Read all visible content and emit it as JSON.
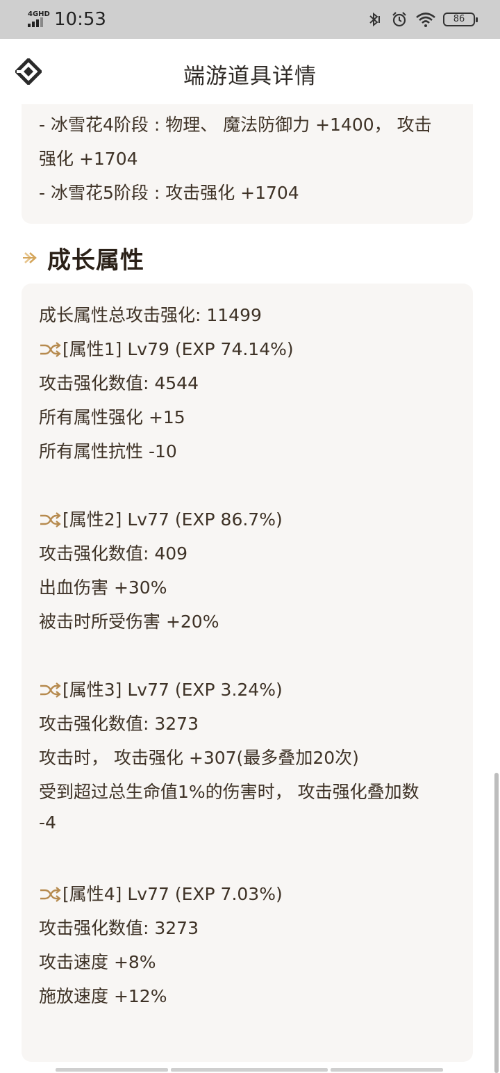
{
  "status_bar": {
    "network": "4GHD",
    "time": "10:53",
    "battery": "86"
  },
  "header": {
    "title": "端游道具详情"
  },
  "set_effects": {
    "lines": [
      "- 冰雪花4阶段 : 物理、 魔法防御力 +1400， 攻击",
      "强化 +1704",
      "- 冰雪花5阶段 : 攻击强化 +1704"
    ]
  },
  "growth": {
    "section_title": "成长属性",
    "total": "成长属性总攻击强化: 11499",
    "attributes": [
      {
        "header": "[属性1] Lv79 (EXP 74.14%)",
        "lines": [
          "攻击强化数值:  4544",
          "所有属性强化 +15",
          "所有属性抗性 -10"
        ]
      },
      {
        "header": "[属性2] Lv77 (EXP 86.7%)",
        "lines": [
          "攻击强化数值:  409",
          "出血伤害 +30%",
          "被击时所受伤害 +20%"
        ]
      },
      {
        "header": "[属性3] Lv77 (EXP 3.24%)",
        "lines": [
          "攻击强化数值:  3273",
          "攻击时， 攻击强化 +307(最多叠加20次)",
          "受到超过总生命值1%的伤害时， 攻击强化叠加数",
          "-4"
        ]
      },
      {
        "header": "[属性4] Lv77 (EXP 7.03%)",
        "lines": [
          "攻击强化数值:  3273",
          "攻击速度 +8%",
          "施放速度 +12%"
        ]
      }
    ]
  },
  "colors": {
    "accent_gold": "#d4a55a",
    "card_bg": "#f8f6f4",
    "text": "#3e3226"
  }
}
